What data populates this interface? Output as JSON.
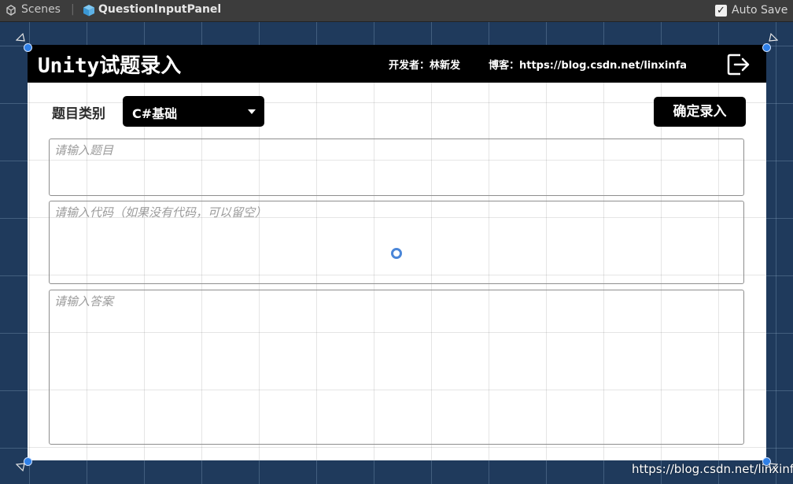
{
  "toolbar": {
    "scenes_label": "Scenes",
    "prefab_name": "QuestionInputPanel",
    "autosave_label": "Auto Save",
    "autosave_checked": true
  },
  "panel": {
    "title": "Unity试题录入",
    "developer": "开发者：林新发",
    "blog": "博客：https://blog.csdn.net/linxinfa",
    "exit_icon": "exit-icon",
    "category_label": "题目类别",
    "category_value": "C#基础",
    "confirm_button": "确定录入",
    "question_placeholder": "请输入题目",
    "code_placeholder": "请输入代码（如果没有代码，可以留空）",
    "answer_placeholder": "请输入答案"
  },
  "watermark": "https://blog.csdn.net/linxinfa",
  "colors": {
    "scene_background": "#1f3a5c",
    "toolbar": "#3c3c3c",
    "header": "#000000",
    "handles": "#2f80e8"
  }
}
